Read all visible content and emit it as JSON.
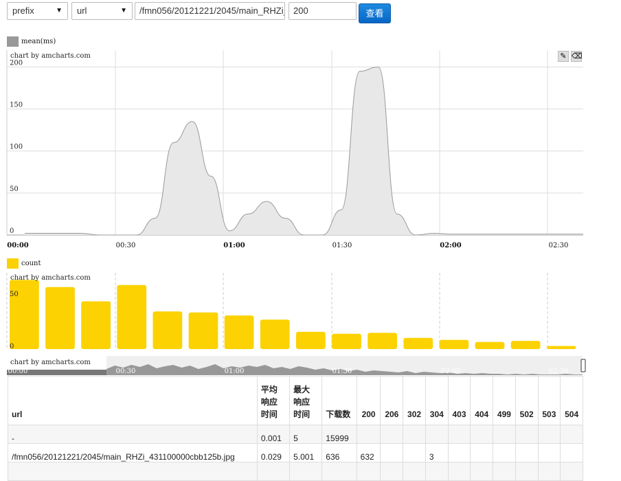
{
  "toolbar": {
    "select1": "prefix",
    "select2": "url",
    "url_input": "/fmn056/20121221/2045/main_RHZi_",
    "code_input": "200",
    "query_button": "查看"
  },
  "mean_chart": {
    "legend": "mean(ms)",
    "credit": "chart by amcharts.com",
    "y_ticks": [
      "200",
      "150",
      "100",
      "50",
      "0"
    ],
    "x_ticks": [
      "00:00",
      "00:30",
      "01:00",
      "01:30",
      "02:00",
      "02:30"
    ],
    "eraser_icons": [
      "eraser-icon",
      "eraser-icon"
    ]
  },
  "count_chart": {
    "legend": "count",
    "credit": "chart by amcharts.com",
    "y_ticks": [
      "50",
      "0"
    ],
    "color": "#fcd202"
  },
  "scrollbar": {
    "credit": "chart by amcharts.com",
    "labels": [
      "00:00",
      "00:30",
      "01:00",
      "01:30",
      "02:00",
      "02:30"
    ]
  },
  "chart_data": [
    {
      "type": "area",
      "title": "",
      "series": [
        {
          "name": "mean(ms)",
          "color": "#999999"
        }
      ],
      "x": [
        "00:00",
        "00:05",
        "00:10",
        "00:15",
        "00:20",
        "00:25",
        "00:30",
        "00:35",
        "00:40",
        "00:45",
        "00:50",
        "00:55",
        "01:00",
        "01:05",
        "01:10",
        "01:15",
        "01:20",
        "01:25",
        "01:30",
        "01:35",
        "01:40",
        "01:45",
        "01:50",
        "01:55",
        "02:00",
        "02:05",
        "02:10",
        "02:15",
        "02:20",
        "02:25",
        "02:30"
      ],
      "y": [
        2,
        2,
        2,
        2,
        0,
        0,
        0,
        20,
        110,
        135,
        70,
        5,
        25,
        40,
        20,
        0,
        0,
        30,
        195,
        200,
        25,
        0,
        2,
        1,
        1,
        1,
        1,
        1,
        1,
        1,
        1
      ],
      "ylim": [
        0,
        220
      ],
      "grid": true
    },
    {
      "type": "bar",
      "series": [
        {
          "name": "count",
          "color": "#fcd202"
        }
      ],
      "values": [
        68,
        61,
        47,
        63,
        37,
        36,
        33,
        29,
        17,
        15,
        16,
        11,
        9,
        7,
        8,
        3
      ],
      "ylim": [
        0,
        75
      ],
      "grid": true
    }
  ],
  "table": {
    "headers": [
      "url",
      "平均\n响应\n时间",
      "最大\n响应\n时间",
      "下载数",
      "200",
      "206",
      "302",
      "304",
      "403",
      "404",
      "499",
      "502",
      "503",
      "504"
    ],
    "rows": [
      [
        "-",
        "0.001",
        "5",
        "15999",
        "",
        "",
        "",
        "",
        "",
        "",
        "",
        "",
        "",
        ""
      ],
      [
        "/fmn056/20121221/2045/main_RHZi_431100000cbb125b.jpg",
        "0.029",
        "5.001",
        "636",
        "632",
        "",
        "",
        "3",
        "",
        "",
        "",
        "",
        "",
        ""
      ]
    ]
  }
}
